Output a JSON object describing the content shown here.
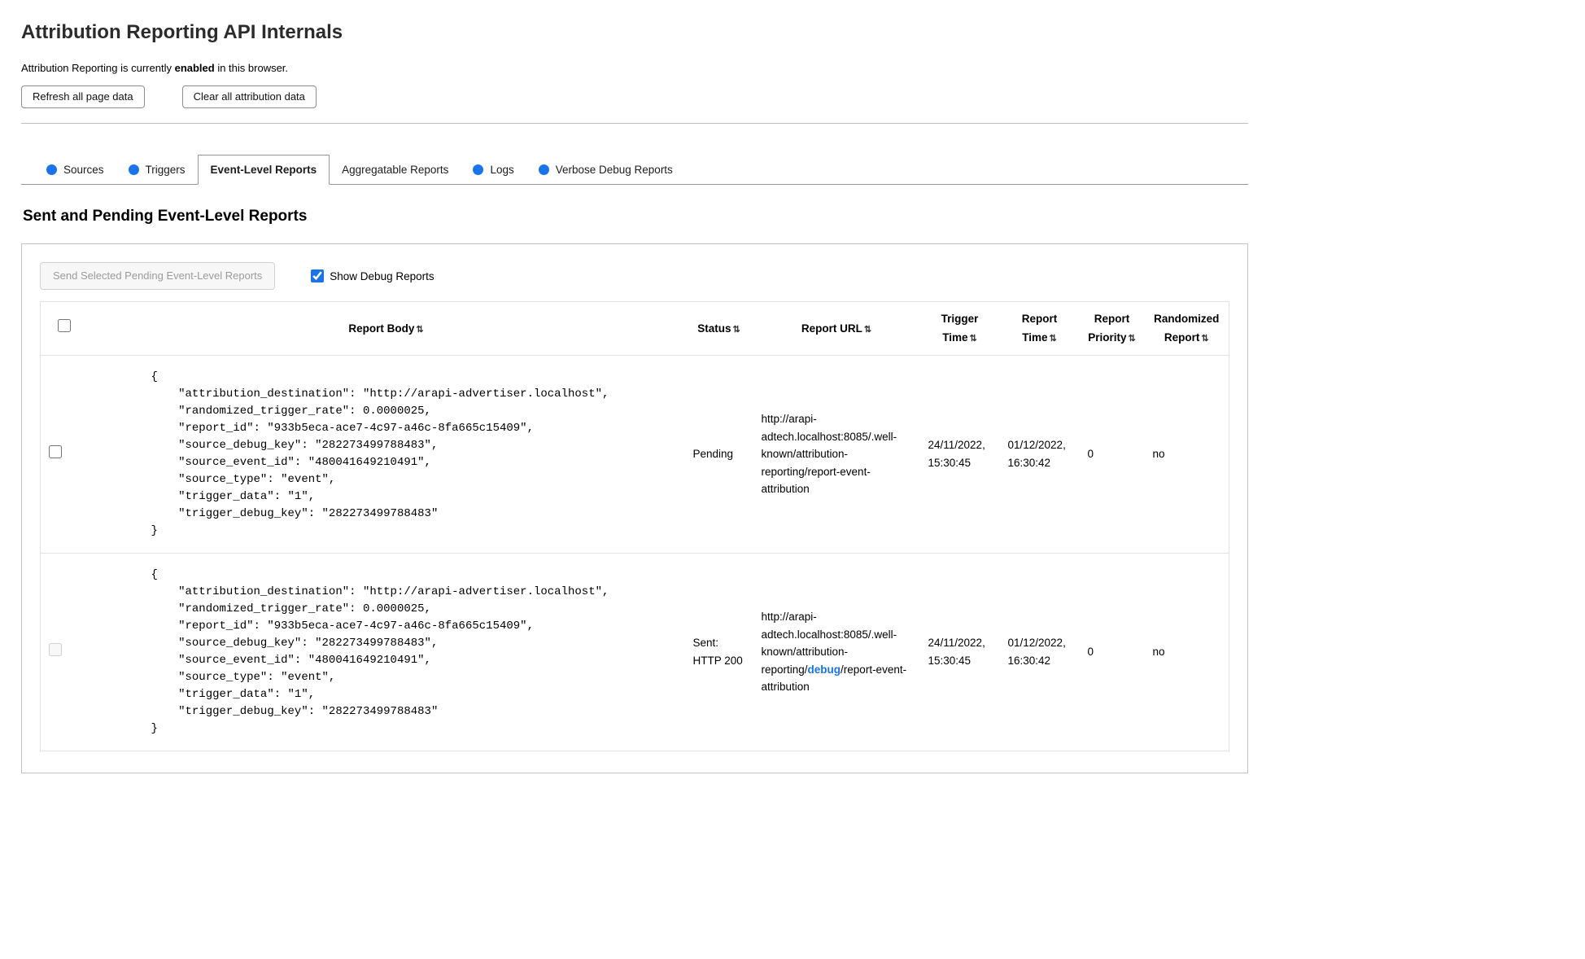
{
  "colors": {
    "accent_blue": "#1a73e8",
    "tab_border": "#979797",
    "table_border": "#e3e3e3"
  },
  "icons": {
    "sort": "⇅",
    "tab_status_dot": "blue-circle"
  },
  "header": {
    "title": "Attribution Reporting API Internals",
    "status_prefix": "Attribution Reporting is currently ",
    "status_bold": "enabled",
    "status_suffix": " in this browser.",
    "refresh_button": "Refresh all page data",
    "clear_button": "Clear all attribution data"
  },
  "tabs": [
    {
      "label": "Sources",
      "has_dot": true,
      "active": false
    },
    {
      "label": "Triggers",
      "has_dot": true,
      "active": false
    },
    {
      "label": "Event-Level Reports",
      "has_dot": false,
      "active": true
    },
    {
      "label": "Aggregatable Reports",
      "has_dot": false,
      "active": false
    },
    {
      "label": "Logs",
      "has_dot": true,
      "active": false
    },
    {
      "label": "Verbose Debug Reports",
      "has_dot": true,
      "active": false
    }
  ],
  "section": {
    "heading": "Sent and Pending Event-Level Reports",
    "send_button": "Send Selected Pending Event-Level Reports",
    "show_debug_label": "Show Debug Reports",
    "show_debug_checked": true
  },
  "table": {
    "headers": {
      "body": "Report Body",
      "status": "Status",
      "url": "Report URL",
      "trigger_time": "Trigger Time",
      "report_time": "Report Time",
      "priority": "Report Priority",
      "randomized": "Randomized Report"
    },
    "rows": [
      {
        "body": "{\n    \"attribution_destination\": \"http://arapi-advertiser.localhost\",\n    \"randomized_trigger_rate\": 0.0000025,\n    \"report_id\": \"933b5eca-ace7-4c97-a46c-8fa665c15409\",\n    \"source_debug_key\": \"282273499788483\",\n    \"source_event_id\": \"480041649210491\",\n    \"source_type\": \"event\",\n    \"trigger_data\": \"1\",\n    \"trigger_debug_key\": \"282273499788483\"\n}",
        "status": "Pending",
        "url_pre": "http://arapi-adtech.localhost:8085/.well-known/attribution-reporting/report-event-attribution",
        "url_debug": "",
        "url_post": "",
        "trigger_time": "24/11/2022, 15:30:45",
        "report_time": "01/12/2022, 16:30:42",
        "priority": "0",
        "randomized": "no",
        "checkbox_enabled": true
      },
      {
        "body": "{\n    \"attribution_destination\": \"http://arapi-advertiser.localhost\",\n    \"randomized_trigger_rate\": 0.0000025,\n    \"report_id\": \"933b5eca-ace7-4c97-a46c-8fa665c15409\",\n    \"source_debug_key\": \"282273499788483\",\n    \"source_event_id\": \"480041649210491\",\n    \"source_type\": \"event\",\n    \"trigger_data\": \"1\",\n    \"trigger_debug_key\": \"282273499788483\"\n}",
        "status": "Sent: HTTP 200",
        "url_pre": "http://arapi-adtech.localhost:8085/.well-known/attribution-reporting/",
        "url_debug": "debug",
        "url_post": "/report-event-attribution",
        "trigger_time": "24/11/2022, 15:30:45",
        "report_time": "01/12/2022, 16:30:42",
        "priority": "0",
        "randomized": "no",
        "checkbox_enabled": false
      }
    ]
  }
}
